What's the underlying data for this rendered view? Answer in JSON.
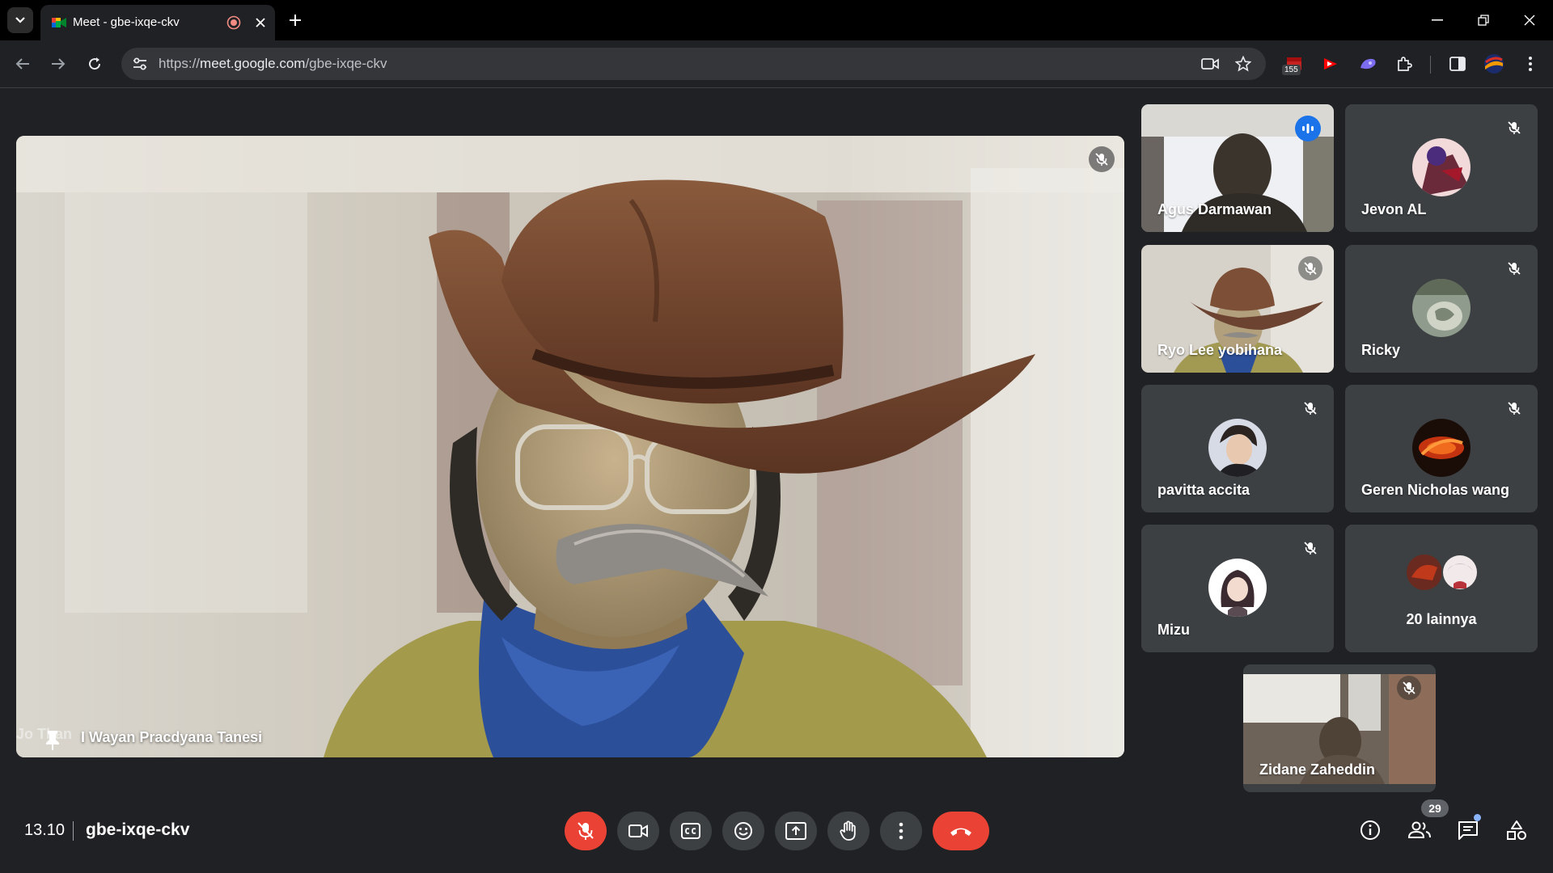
{
  "browser": {
    "tab_title": "Meet - gbe-ixqe-ckv",
    "url_scheme": "https://",
    "url_host": "meet.google.com",
    "url_path": "/gbe-ixqe-ckv",
    "extension_badge": "155"
  },
  "main_speaker": {
    "name": "I Wayan Pracdyana Tanesi",
    "overlay_text": "Jo Than"
  },
  "participants": [
    {
      "name": "Agus Darmawan",
      "state": "speaking"
    },
    {
      "name": "Jevon AL",
      "state": "muted"
    },
    {
      "name": "Ryo Lee yobihana",
      "state": "muted"
    },
    {
      "name": "Ricky",
      "state": "muted"
    },
    {
      "name": "pavitta accita",
      "state": "muted"
    },
    {
      "name": "Geren Nicholas wang",
      "state": "muted"
    },
    {
      "name": "Mizu",
      "state": "muted"
    }
  ],
  "others_tile": {
    "label": "20 lainnya"
  },
  "self_view": {
    "name": "Zidane Zaheddin",
    "state": "muted"
  },
  "bottom_bar": {
    "time": "13.10",
    "meeting_code": "gbe-ixqe-ckv",
    "people_count": "29"
  },
  "colors": {
    "background": "#202124",
    "tile": "#3c4043",
    "accent_blue": "#8ab4f8",
    "speaking_blue": "#1a73e8",
    "danger_red": "#ea4335"
  }
}
